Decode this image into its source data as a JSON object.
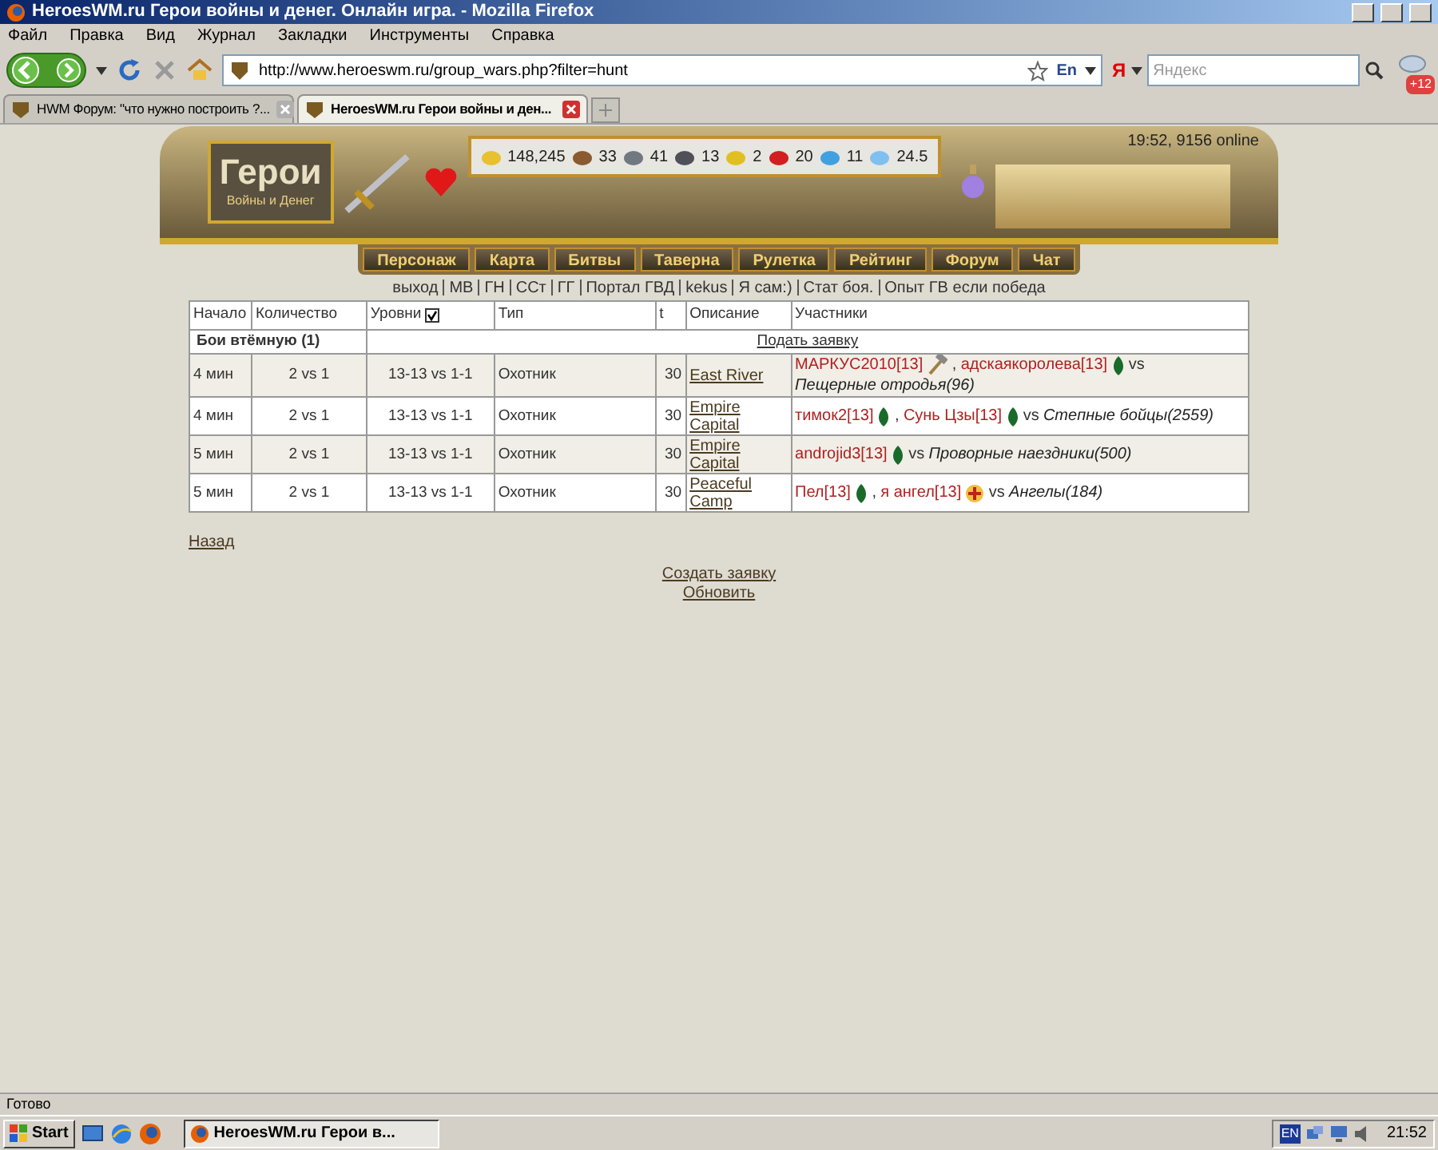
{
  "window": {
    "title": "HeroesWM.ru Герои войны и денег. Онлайн игра. - Mozilla Firefox"
  },
  "menu": [
    "Файл",
    "Правка",
    "Вид",
    "Журнал",
    "Закладки",
    "Инструменты",
    "Справка"
  ],
  "toolbar": {
    "url": "http://www.heroeswm.ru/group_wars.php?filter=hunt",
    "language": "En",
    "search_placeholder": "Яндекс",
    "search_engine": "Я",
    "badge": "+12"
  },
  "tabs": [
    {
      "label": "HWM Форум: \"что нужно построить ?...",
      "selected": false
    },
    {
      "label": "HeroesWM.ru Герои войны и ден...",
      "selected": true
    }
  ],
  "game": {
    "logo_title": "Герои",
    "logo_subtitle": "Войны и Денег",
    "online": "19:52, 9156 online",
    "resources": [
      {
        "kind": "gold",
        "value": "148,245"
      },
      {
        "kind": "wood",
        "value": "33"
      },
      {
        "kind": "ore",
        "value": "41"
      },
      {
        "kind": "mercury",
        "value": "13"
      },
      {
        "kind": "sulfur",
        "value": "2"
      },
      {
        "kind": "crystal",
        "value": "20"
      },
      {
        "kind": "gems",
        "value": "11"
      },
      {
        "kind": "diamond",
        "value": "24.5"
      }
    ],
    "nav": [
      "Персонаж",
      "Карта",
      "Битвы",
      "Таверна",
      "Рулетка",
      "Рейтинг",
      "Форум",
      "Чат"
    ],
    "links": [
      "выход",
      "МВ",
      "ГН",
      "ССт",
      "ГГ",
      "Портал ГВД",
      "kekus",
      "Я сам:)",
      "Стат боя.",
      "Опыт ГВ если победа"
    ]
  },
  "table": {
    "columns": [
      "Начало",
      "Количество",
      "Уровни",
      "Тип",
      "t",
      "Описание",
      "Участники"
    ],
    "levels_checked": true,
    "section": {
      "title": "Бои втёмную (1)",
      "action": "Подать заявку"
    },
    "rows": [
      {
        "start": "4 мин",
        "count": "2 vs 1",
        "levels": "13-13 vs 1-1",
        "type": "Охотник",
        "t": "30",
        "description": "East River",
        "participants": [
          {
            "kind": "player",
            "text": "МАРКУС2010[13]"
          },
          {
            "kind": "hammer"
          },
          {
            "kind": "text",
            "text": ","
          },
          {
            "kind": "player",
            "text": "адскаякоролева[13]"
          },
          {
            "kind": "leaf"
          },
          {
            "kind": "text",
            "text": "vs"
          },
          {
            "kind": "enemy",
            "text": "Пещерные отродья(96)"
          }
        ]
      },
      {
        "start": "4 мин",
        "count": "2 vs 1",
        "levels": "13-13 vs 1-1",
        "type": "Охотник",
        "t": "30",
        "description": "Empire Capital",
        "participants": [
          {
            "kind": "player",
            "text": "тимок2[13]"
          },
          {
            "kind": "leaf"
          },
          {
            "kind": "text",
            "text": ","
          },
          {
            "kind": "player",
            "text": "Сунь Цзы[13]"
          },
          {
            "kind": "leaf"
          },
          {
            "kind": "text",
            "text": "vs"
          },
          {
            "kind": "enemy",
            "text": "Степные бойцы(2559)"
          }
        ]
      },
      {
        "start": "5 мин",
        "count": "2 vs 1",
        "levels": "13-13 vs 1-1",
        "type": "Охотник",
        "t": "30",
        "description": "Empire Capital",
        "participants": [
          {
            "kind": "player",
            "text": "androjid3[13]"
          },
          {
            "kind": "leaf"
          },
          {
            "kind": "text",
            "text": "vs"
          },
          {
            "kind": "enemy",
            "text": "Проворные наездники(500)"
          }
        ]
      },
      {
        "start": "5 мин",
        "count": "2 vs 1",
        "levels": "13-13 vs 1-1",
        "type": "Охотник",
        "t": "30",
        "description": "Peaceful Camp",
        "participants": [
          {
            "kind": "player",
            "text": "Пел[13]"
          },
          {
            "kind": "leaf"
          },
          {
            "kind": "text",
            "text": ","
          },
          {
            "kind": "player",
            "text": "я ангел[13]"
          },
          {
            "kind": "cross"
          },
          {
            "kind": "text",
            "text": "vs"
          },
          {
            "kind": "enemy",
            "text": "Ангелы(184)"
          }
        ]
      }
    ]
  },
  "back": "Назад",
  "actions": [
    "Создать заявку",
    "Обновить"
  ],
  "status_bar": "Готово",
  "taskbar": {
    "start": "Start",
    "task": "HeroesWM.ru Герои в...",
    "language": "EN",
    "clock": "21:52"
  }
}
